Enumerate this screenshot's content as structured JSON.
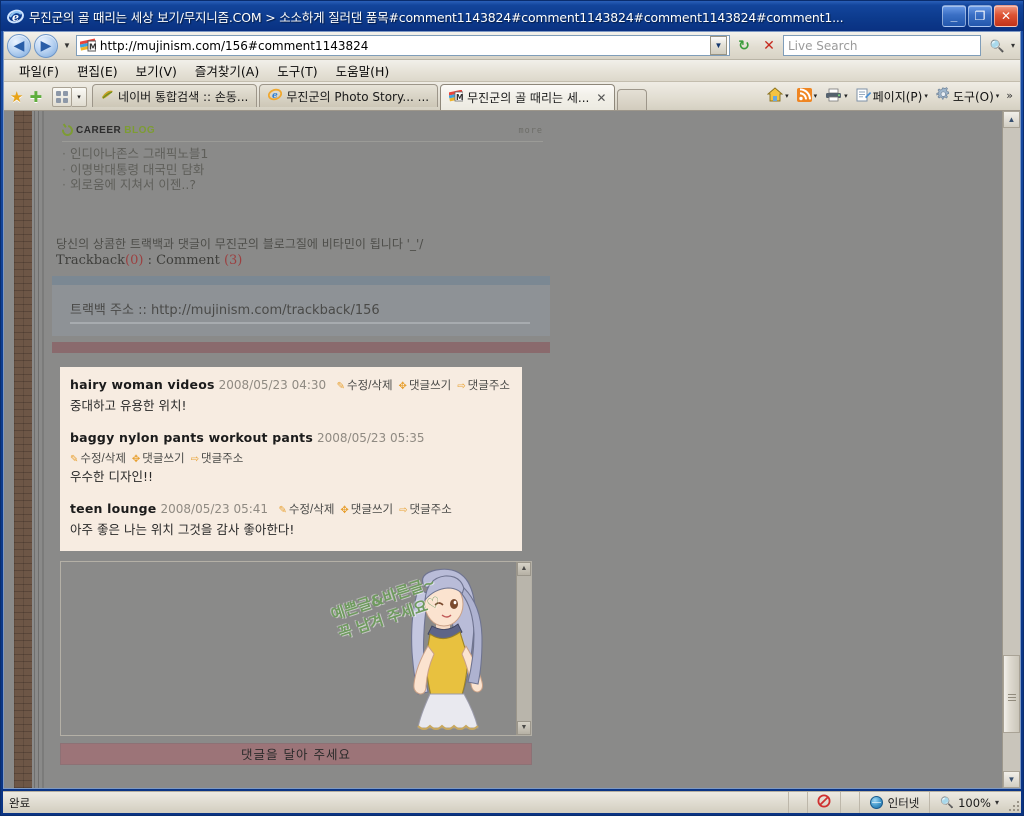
{
  "window": {
    "title": "무진군의 골 때리는 세상 보기/무지니즘.COM > 소소하게 질러댄 품목#comment1143824#comment1143824#comment1143824#comment1...",
    "title_icon": "ie-logo-icon",
    "minimize_label": "_",
    "maximize_label": "❐",
    "close_label": "✕"
  },
  "toolbar": {
    "back_label": "◀",
    "forward_label": "▶",
    "nav_dropdown_label": "▼",
    "address_favicon": "mujinism-favicon",
    "address_value": "http://mujinism.com/156#comment1143824",
    "address_dropdown_label": "▼",
    "refresh_label": "↻",
    "stop_label": "✕",
    "search_placeholder": "Live Search",
    "search_value": "",
    "search_go_label": "🔍",
    "search_dropdown_label": "▾"
  },
  "menubar": {
    "items": [
      {
        "label": "파일(F)",
        "accel": "F"
      },
      {
        "label": "편집(E)",
        "accel": "E"
      },
      {
        "label": "보기(V)",
        "accel": "V"
      },
      {
        "label": "즐겨찾기(A)",
        "accel": "A"
      },
      {
        "label": "도구(T)",
        "accel": "T"
      },
      {
        "label": "도움말(H)",
        "accel": "H"
      }
    ]
  },
  "tabbar": {
    "favorites_label": "★",
    "add_favorite_label": "✚",
    "quicktabs_label": "⊞",
    "quicktabs_dropdown_label": "▾",
    "tabs": [
      {
        "label": "네이버 통합검색 :: 손동...",
        "active": false,
        "icon": "naver-icon"
      },
      {
        "label": "무진군의 Photo Story... ...",
        "active": false,
        "icon": "ie-icon"
      },
      {
        "label": "무진군의 골 때리는 세...",
        "active": true,
        "icon": "mujinism-icon",
        "close_label": "✕"
      }
    ],
    "right_items": [
      {
        "label": "",
        "icon": "home-icon",
        "caret": "▾"
      },
      {
        "label": "",
        "icon": "rss-icon",
        "caret": "▾"
      },
      {
        "label": "",
        "icon": "print-icon",
        "caret": "▾"
      },
      {
        "label": "페이지(P)",
        "icon": "page-icon",
        "caret": "▾"
      },
      {
        "label": "도구(O)",
        "icon": "gear-icon",
        "caret": "▾"
      }
    ],
    "overflow_label": "»"
  },
  "page": {
    "careerblog": {
      "logo_career": "CAREER",
      "logo_blog": "BLOG",
      "more_label": "more",
      "links": [
        "인디아나존스 그래픽노블1",
        "이명박대통령 대국민 담화",
        "외로움에 지쳐서 이젠..?"
      ]
    },
    "trackback": {
      "intro": "당신의 상콤한 트랙백과 댓글이 무진군의 블로그질에 비타민이 됩니다 '_'/",
      "counts_prefix": "Trackback",
      "trackback_count": "(0)",
      "separator": " : ",
      "comment_label": "Comment ",
      "comment_count": "(3)",
      "address_label": "트랙백 주소 :: ",
      "address_url": "http://mujinism.com/trackback/156"
    },
    "comments": [
      {
        "author": "hairy woman videos",
        "date": "2008/05/23 04:30",
        "actions": [
          "수정/삭제",
          "댓글쓰기",
          "댓글주소"
        ],
        "body": "중대하고 유용한 위치!",
        "actions_inline": true
      },
      {
        "author": "baggy nylon pants workout pants",
        "date": "2008/05/23 05:35",
        "actions": [
          "수정/삭제",
          "댓글쓰기",
          "댓글주소"
        ],
        "body": "우수한 디자인!!",
        "actions_inline": false
      },
      {
        "author": "teen lounge",
        "date": "2008/05/23 05:41",
        "actions": [
          "수정/삭제",
          "댓글쓰기",
          "댓글주소"
        ],
        "body": "아주 좋은 나는 위치 그것을 감사 좋아한다!",
        "actions_inline": true
      }
    ],
    "comment_image": {
      "caption_line1": "예쁜글&바른글~",
      "caption_line2": "꼭 남겨 주세요♡",
      "scroll_up_label": "▲",
      "scroll_down_label": "▼"
    },
    "write_comment_button": "댓글을 달아 주세요",
    "scrollbar": {
      "up_label": "▲",
      "down_label": "▼"
    }
  },
  "statusbar": {
    "status_text": "완료",
    "blocked_icon": "popup-blocked-icon",
    "zone_icon": "internet-globe-icon",
    "zone_label": "인터넷",
    "zoom_label": "100%",
    "zoom_dropdown_label": "▾"
  },
  "colors": {
    "titlebar_blue": "#0b3c91",
    "chrome_beige": "#e8e4da",
    "page_gray": "#8a8a89",
    "comment_cream": "#f7ece1",
    "pink_bar": "#8a6a6d",
    "pink_button": "#9c7478",
    "accent_red": "#9c4040",
    "careerblog_green": "#7d9c33",
    "link_orange": "#e8a030",
    "brick_brown": "#6d5646"
  }
}
